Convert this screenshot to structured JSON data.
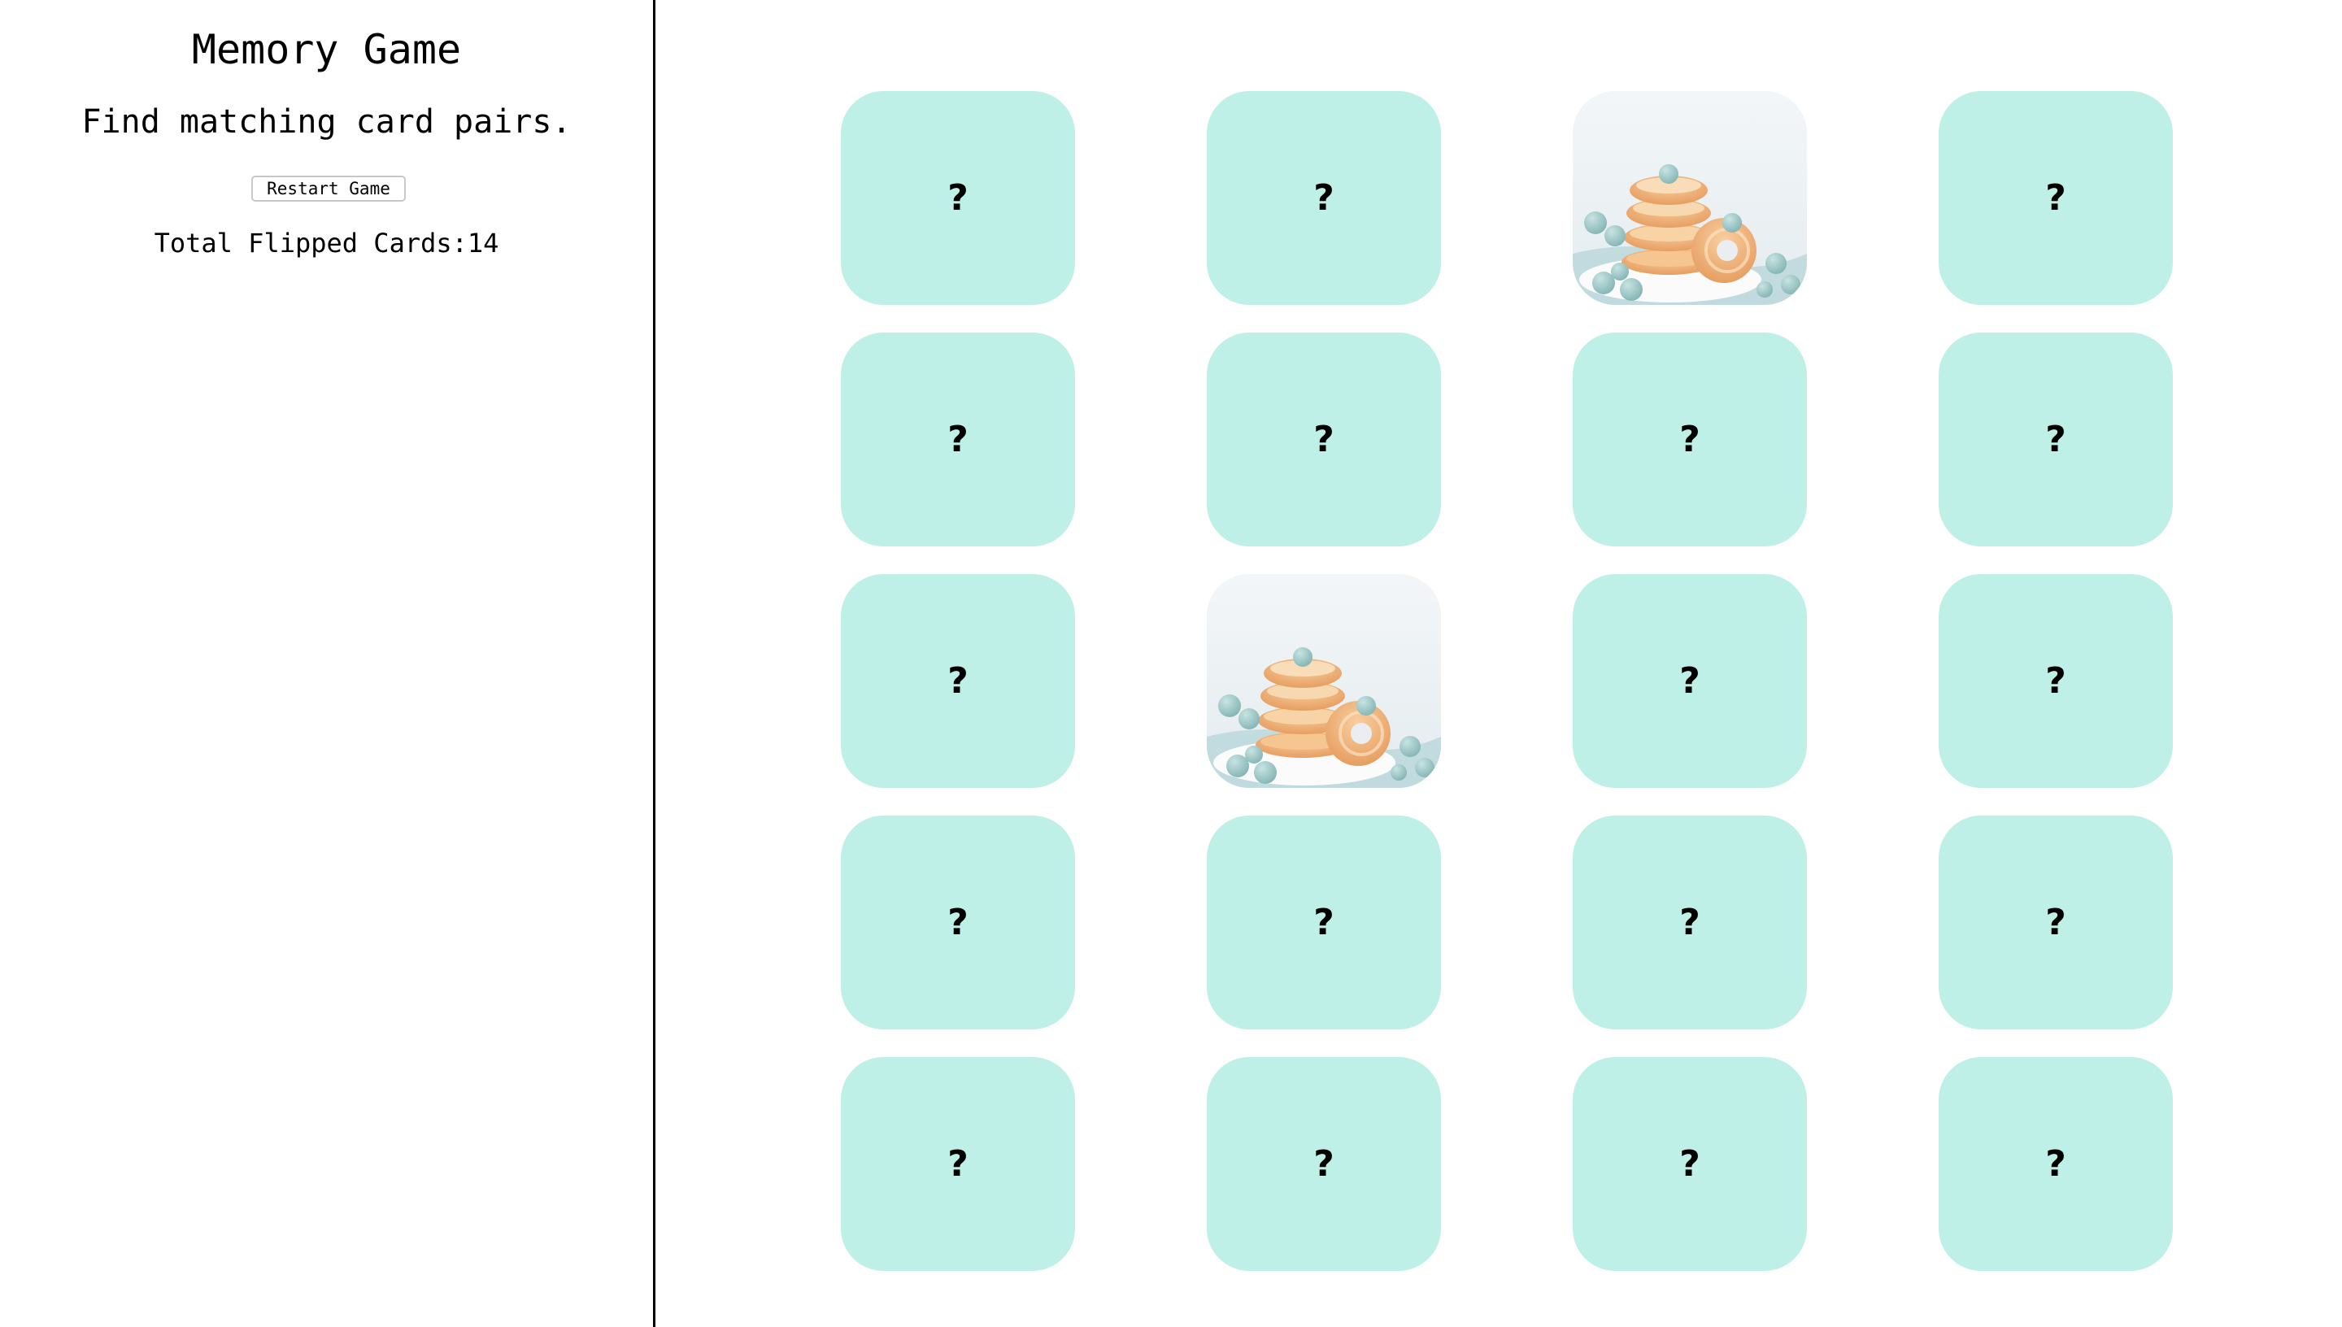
{
  "sidebar": {
    "title": "Memory Game",
    "subtitle": "Find matching card pairs.",
    "restart_label": "Restart Game",
    "counter_label": "Total Flipped Cards:",
    "counter_value": "14"
  },
  "colors": {
    "card_back": "#bff0e7",
    "divider": "#000000"
  },
  "board": {
    "rows": 5,
    "columns": 4,
    "cards": [
      {
        "state": "hidden",
        "mark": "?"
      },
      {
        "state": "hidden",
        "mark": "?"
      },
      {
        "state": "flipped",
        "image": "donut-stack-image"
      },
      {
        "state": "hidden",
        "mark": "?"
      },
      {
        "state": "hidden",
        "mark": "?"
      },
      {
        "state": "hidden",
        "mark": "?"
      },
      {
        "state": "hidden",
        "mark": "?"
      },
      {
        "state": "hidden",
        "mark": "?"
      },
      {
        "state": "hidden",
        "mark": "?"
      },
      {
        "state": "flipped",
        "image": "donut-stack-image"
      },
      {
        "state": "hidden",
        "mark": "?"
      },
      {
        "state": "hidden",
        "mark": "?"
      },
      {
        "state": "hidden",
        "mark": "?"
      },
      {
        "state": "hidden",
        "mark": "?"
      },
      {
        "state": "hidden",
        "mark": "?"
      },
      {
        "state": "hidden",
        "mark": "?"
      },
      {
        "state": "hidden",
        "mark": "?"
      },
      {
        "state": "hidden",
        "mark": "?"
      },
      {
        "state": "hidden",
        "mark": "?"
      },
      {
        "state": "hidden",
        "mark": "?"
      }
    ]
  }
}
